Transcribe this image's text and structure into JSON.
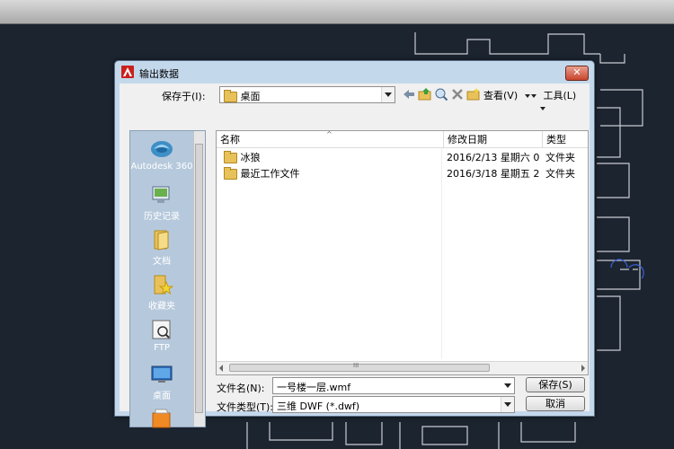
{
  "dialog": {
    "title": "输出数据",
    "close_glyph": "✕"
  },
  "savein": {
    "label": "保存于(I):",
    "value": "桌面"
  },
  "toolbar": {
    "view_label": "查看(V)",
    "tools_label": "工具(L)"
  },
  "places": [
    {
      "label": "Autodesk 360",
      "icon": "cloud-icon"
    },
    {
      "label": "历史记录",
      "icon": "history-icon"
    },
    {
      "label": "文档",
      "icon": "documents-icon"
    },
    {
      "label": "收藏夹",
      "icon": "favorites-icon"
    },
    {
      "label": "FTP",
      "icon": "ftp-icon"
    },
    {
      "label": "桌面",
      "icon": "desktop-icon"
    }
  ],
  "filelist": {
    "columns": [
      "名称",
      "修改日期",
      "类型"
    ],
    "rows": [
      {
        "name": "冰狼",
        "date": "2016/2/13 星期六 0...",
        "type": "文件夹"
      },
      {
        "name": "最近工作文件",
        "date": "2016/3/18 星期五 2...",
        "type": "文件夹"
      }
    ],
    "scroll_mark": "III"
  },
  "filename": {
    "label": "文件名(N):",
    "value": "一号楼一层.wmf"
  },
  "filetype": {
    "label": "文件类型(T):",
    "value": "三维 DWF (*.dwf)"
  },
  "buttons": {
    "save": "保存(S)",
    "cancel": "取消"
  },
  "colors": {
    "cad_background": "#1c2430",
    "dialog_frame": "#c4d8ec",
    "folder": "#e8c15a"
  }
}
